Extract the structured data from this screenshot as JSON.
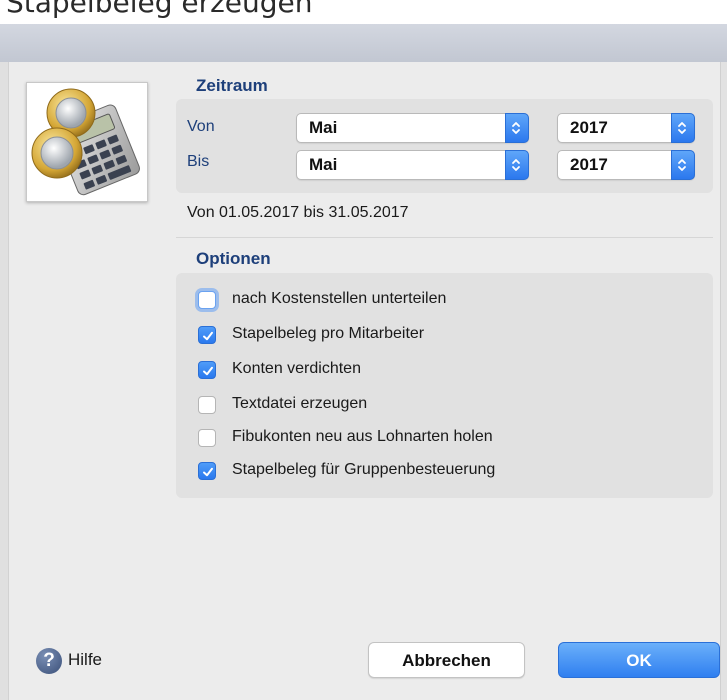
{
  "top_caption": "Stapelbeleg erzeugen",
  "zeitraum": {
    "title": "Zeitraum",
    "von_label": "Von",
    "bis_label": "Bis",
    "von_month": "Mai",
    "von_year": "2017",
    "bis_month": "Mai",
    "bis_year": "2017",
    "range_text": "Von 01.05.2017 bis 31.05.2017"
  },
  "optionen": {
    "title": "Optionen",
    "items": [
      {
        "label": "nach Kostenstellen unterteilen",
        "checked": false
      },
      {
        "label": "Stapelbeleg pro Mitarbeiter",
        "checked": true
      },
      {
        "label": "Konten verdichten",
        "checked": true
      },
      {
        "label": "Textdatei erzeugen",
        "checked": false
      },
      {
        "label": "Fibukonten neu aus Lohnarten holen",
        "checked": false
      },
      {
        "label": "Stapelbeleg für Gruppenbesteuerung",
        "checked": true
      }
    ]
  },
  "footer": {
    "help_label": "Hilfe",
    "cancel_label": "Abbrechen",
    "ok_label": "OK"
  },
  "colors": {
    "accent": "#2b78ee",
    "section_title": "#1d3f7a"
  }
}
